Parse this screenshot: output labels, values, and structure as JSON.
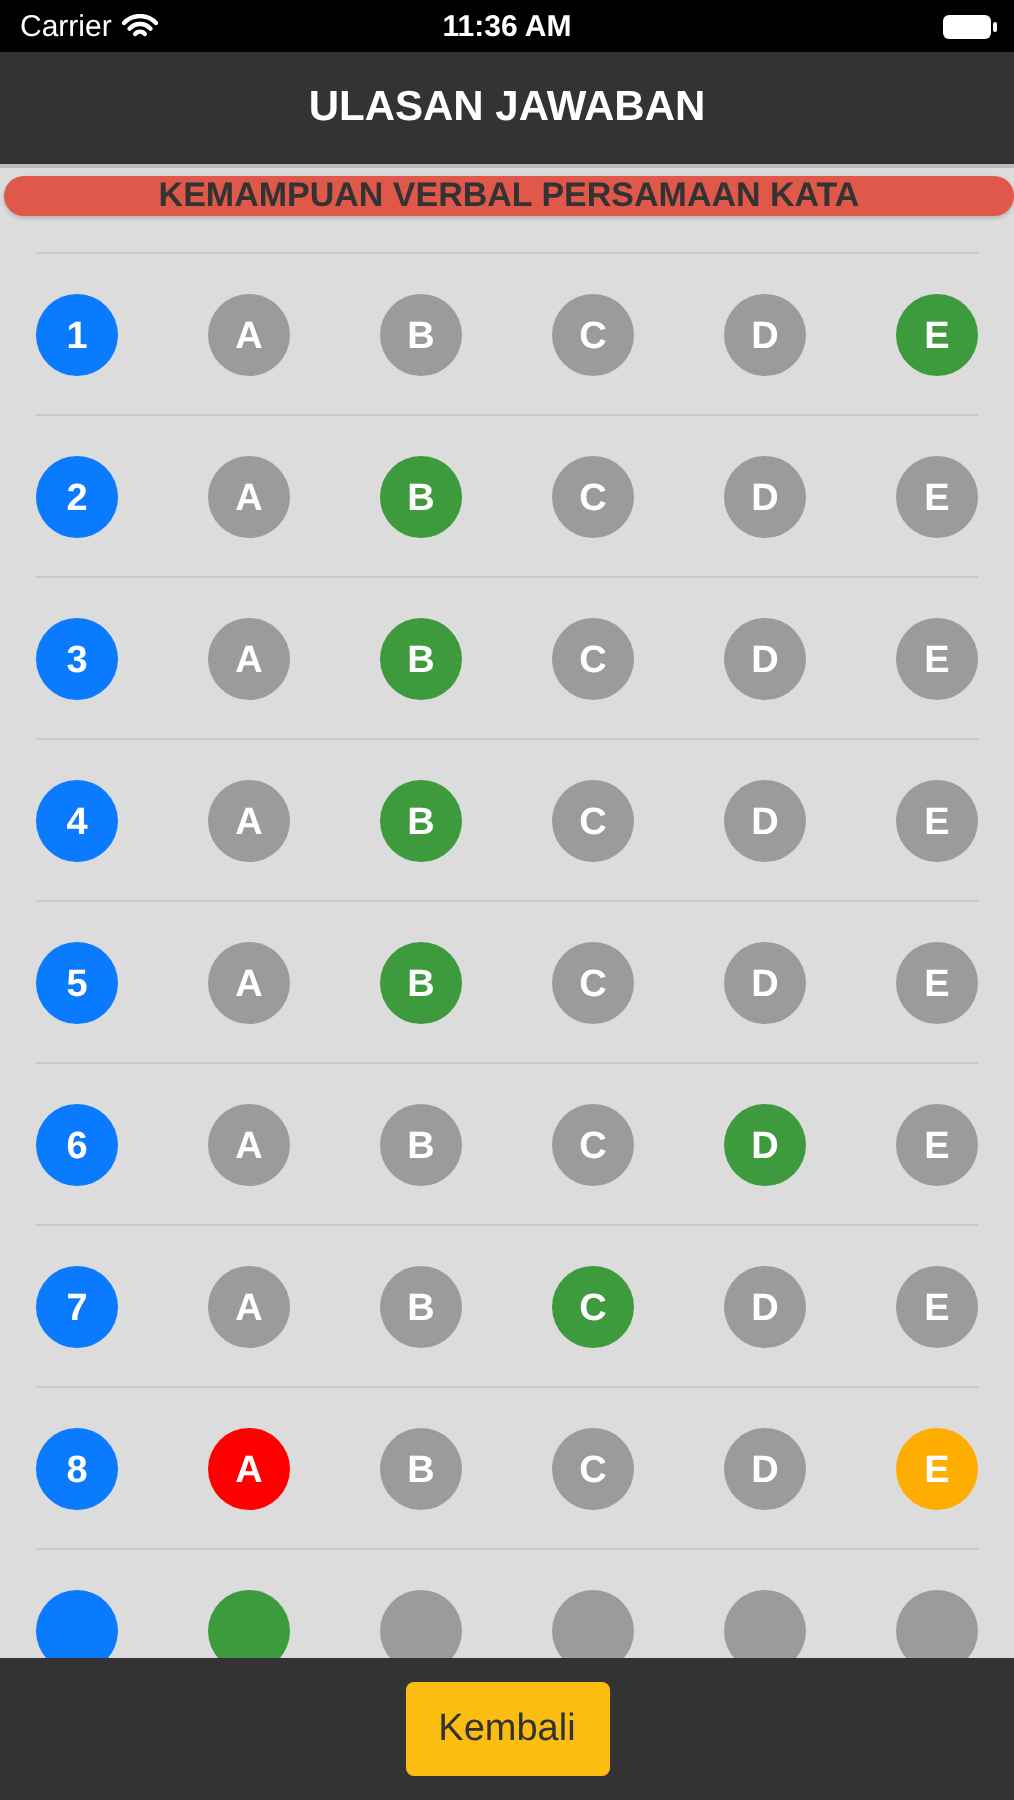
{
  "status_bar": {
    "carrier": "Carrier",
    "time": "11:36 AM"
  },
  "header": {
    "title": "ULASAN JAWABAN"
  },
  "section": {
    "title": "KEMAMPUAN VERBAL PERSAMAAN KATA"
  },
  "questions": [
    {
      "number": "1",
      "options": [
        {
          "label": "A",
          "kind": "neutral"
        },
        {
          "label": "B",
          "kind": "neutral"
        },
        {
          "label": "C",
          "kind": "neutral"
        },
        {
          "label": "D",
          "kind": "neutral"
        },
        {
          "label": "E",
          "kind": "correct"
        }
      ]
    },
    {
      "number": "2",
      "options": [
        {
          "label": "A",
          "kind": "neutral"
        },
        {
          "label": "B",
          "kind": "correct"
        },
        {
          "label": "C",
          "kind": "neutral"
        },
        {
          "label": "D",
          "kind": "neutral"
        },
        {
          "label": "E",
          "kind": "neutral"
        }
      ]
    },
    {
      "number": "3",
      "options": [
        {
          "label": "A",
          "kind": "neutral"
        },
        {
          "label": "B",
          "kind": "correct"
        },
        {
          "label": "C",
          "kind": "neutral"
        },
        {
          "label": "D",
          "kind": "neutral"
        },
        {
          "label": "E",
          "kind": "neutral"
        }
      ]
    },
    {
      "number": "4",
      "options": [
        {
          "label": "A",
          "kind": "neutral"
        },
        {
          "label": "B",
          "kind": "correct"
        },
        {
          "label": "C",
          "kind": "neutral"
        },
        {
          "label": "D",
          "kind": "neutral"
        },
        {
          "label": "E",
          "kind": "neutral"
        }
      ]
    },
    {
      "number": "5",
      "options": [
        {
          "label": "A",
          "kind": "neutral"
        },
        {
          "label": "B",
          "kind": "correct"
        },
        {
          "label": "C",
          "kind": "neutral"
        },
        {
          "label": "D",
          "kind": "neutral"
        },
        {
          "label": "E",
          "kind": "neutral"
        }
      ]
    },
    {
      "number": "6",
      "options": [
        {
          "label": "A",
          "kind": "neutral"
        },
        {
          "label": "B",
          "kind": "neutral"
        },
        {
          "label": "C",
          "kind": "neutral"
        },
        {
          "label": "D",
          "kind": "correct"
        },
        {
          "label": "E",
          "kind": "neutral"
        }
      ]
    },
    {
      "number": "7",
      "options": [
        {
          "label": "A",
          "kind": "neutral"
        },
        {
          "label": "B",
          "kind": "neutral"
        },
        {
          "label": "C",
          "kind": "correct"
        },
        {
          "label": "D",
          "kind": "neutral"
        },
        {
          "label": "E",
          "kind": "neutral"
        }
      ]
    },
    {
      "number": "8",
      "options": [
        {
          "label": "A",
          "kind": "wrong"
        },
        {
          "label": "B",
          "kind": "neutral"
        },
        {
          "label": "C",
          "kind": "neutral"
        },
        {
          "label": "D",
          "kind": "neutral"
        },
        {
          "label": "E",
          "kind": "missed"
        }
      ]
    }
  ],
  "partial_row": {
    "options": [
      {
        "kind": "correct"
      },
      {
        "kind": "neutral"
      },
      {
        "kind": "neutral"
      },
      {
        "kind": "neutral"
      },
      {
        "kind": "neutral"
      }
    ]
  },
  "footer": {
    "button": "Kembali"
  }
}
